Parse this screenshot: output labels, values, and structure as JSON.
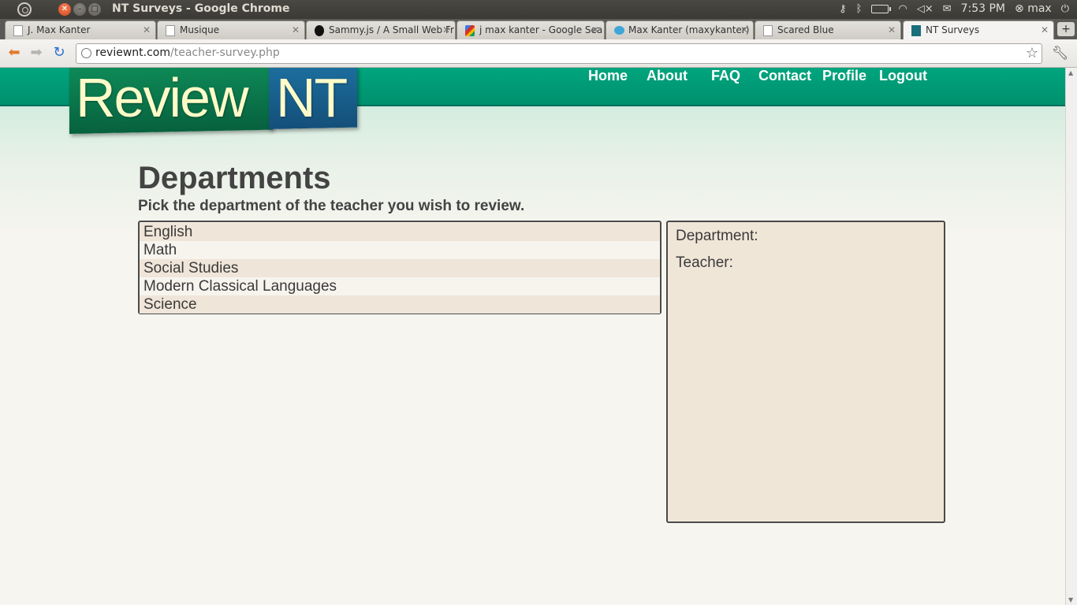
{
  "os": {
    "window_title": "NT Surveys - Google Chrome",
    "clock": "7:53 PM",
    "user": "max"
  },
  "tabs": [
    {
      "label": "J. Max Kanter",
      "icon": "page-icon"
    },
    {
      "label": "Musique",
      "icon": "page-icon"
    },
    {
      "label": "Sammy.js / A Small Web Fr",
      "icon": "sammy-icon"
    },
    {
      "label": "j max kanter - Google Sea",
      "icon": "google-icon"
    },
    {
      "label": "Max Kanter (maxykanter)",
      "icon": "twitter-icon"
    },
    {
      "label": "Scared Blue",
      "icon": "page-icon"
    },
    {
      "label": "NT Surveys",
      "icon": "nt-icon"
    }
  ],
  "toolbar": {
    "url_host": "reviewnt.com",
    "url_path": "/teacher-survey.php"
  },
  "site": {
    "logo_left": "Review",
    "logo_right": "NT",
    "nav": [
      "Home",
      "About",
      "FAQ",
      "Contact",
      "Profile",
      "Logout"
    ]
  },
  "main": {
    "title": "Departments",
    "subtitle": "Pick the department of the teacher you wish to review.",
    "departments": [
      "English",
      "Math",
      "Social Studies",
      "Modern Classical Languages",
      "Science"
    ],
    "info": {
      "department_label": "Department:",
      "teacher_label": "Teacher:"
    }
  },
  "colors": {
    "header_green": "#00a57e",
    "logo_green": "#0e8a58",
    "logo_blue": "#1c6e9e",
    "logo_text": "#fffbc8",
    "list_odd": "#efe5d8",
    "info_bg": "#f0e6d8"
  }
}
